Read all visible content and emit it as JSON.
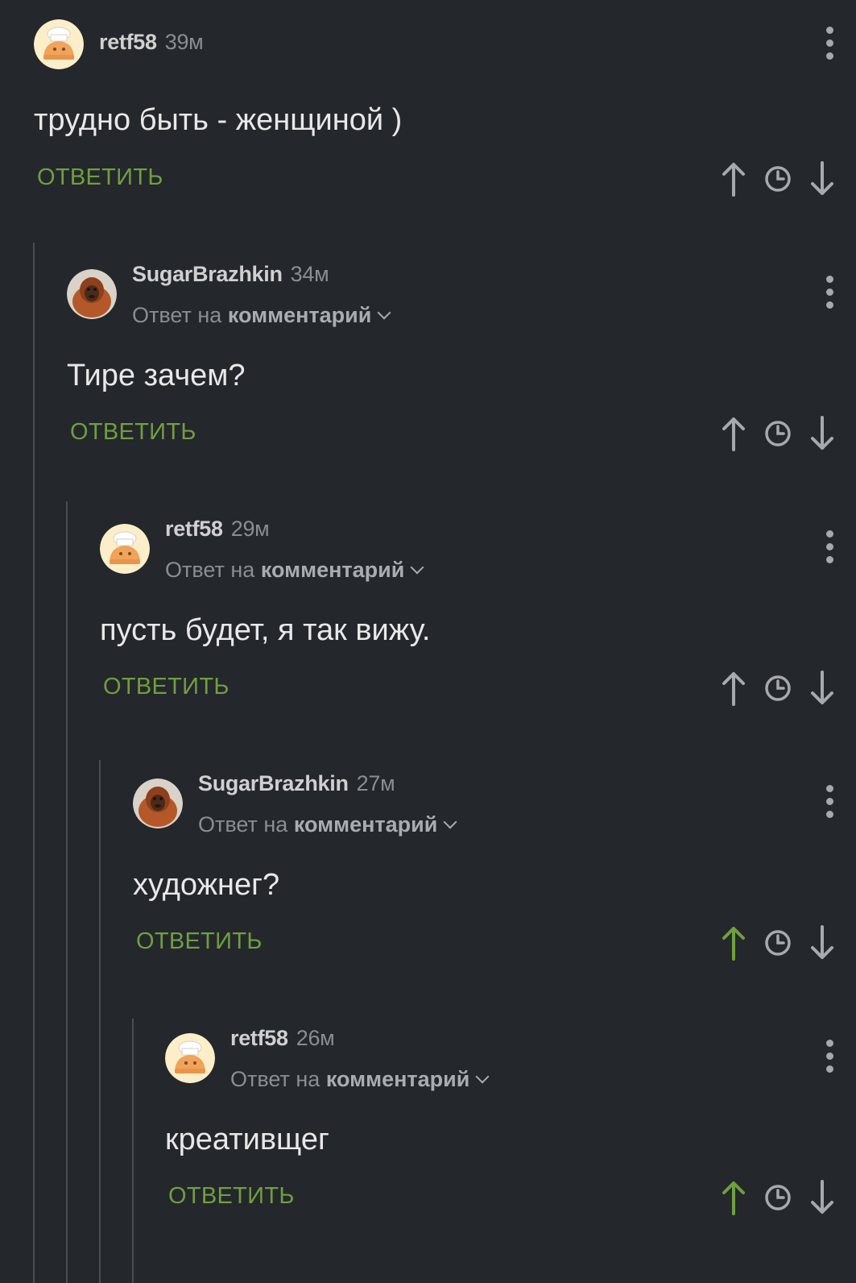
{
  "colors": {
    "background": "#24272b",
    "accent_green": "#6f9f3f",
    "icon_gray": "#a6a9ad",
    "thread_line": "#4a4d52"
  },
  "comments": [
    {
      "username": "retf58",
      "time": "39м",
      "reply_prefix": "",
      "reply_target": "",
      "text": "трудно быть - женщиной )",
      "reply_label": "ОТВЕТИТЬ",
      "avatar": "chef-avatar",
      "upvoted": false
    },
    {
      "username": "SugarBrazhkin",
      "time": "34м",
      "reply_prefix": "Ответ на",
      "reply_target": "комментарий",
      "text": "Тире зачем?",
      "reply_label": "ОТВЕТИТЬ",
      "avatar": "orangutan-avatar",
      "upvoted": false
    },
    {
      "username": "retf58",
      "time": "29м",
      "reply_prefix": "Ответ на",
      "reply_target": "комментарий",
      "text": "пусть будет, я так вижу.",
      "reply_label": "ОТВЕТИТЬ",
      "avatar": "chef-avatar",
      "upvoted": false
    },
    {
      "username": "SugarBrazhkin",
      "time": "27м",
      "reply_prefix": "Ответ на",
      "reply_target": "комментарий",
      "text": "художнег?",
      "reply_label": "ОТВЕТИТЬ",
      "avatar": "orangutan-avatar",
      "upvoted": true
    },
    {
      "username": "retf58",
      "time": "26м",
      "reply_prefix": "Ответ на",
      "reply_target": "комментарий",
      "text": "креативщег",
      "reply_label": "ОТВЕТИТЬ",
      "avatar": "chef-avatar",
      "upvoted": true
    }
  ]
}
